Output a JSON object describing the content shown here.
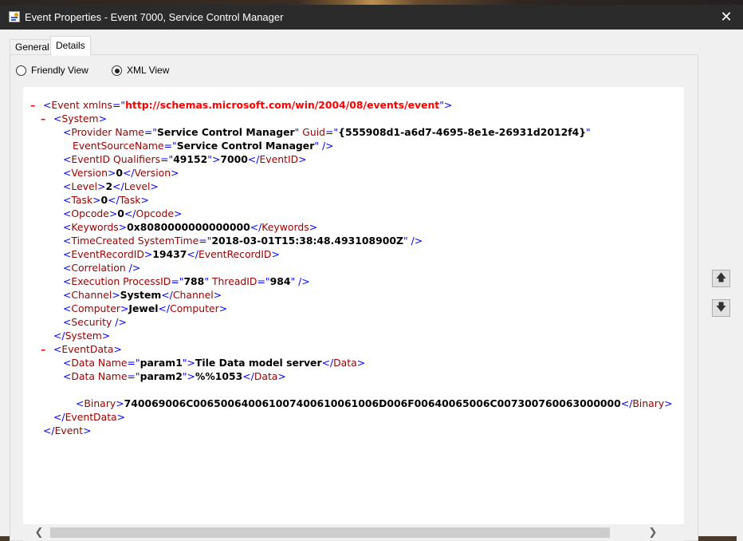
{
  "window": {
    "title": "Event Properties - Event 7000, Service Control Manager",
    "close_glyph": "✕"
  },
  "tabs": [
    {
      "label": "General",
      "selected": false
    },
    {
      "label": "Details",
      "selected": true
    }
  ],
  "view_options": {
    "friendly_label": "Friendly View",
    "xml_label": "XML View",
    "selected": "XML View"
  },
  "xml_view": {
    "lines": [
      {
        "indent": 0,
        "collapse": "–",
        "tokens": [
          [
            "t",
            "<"
          ],
          [
            "n",
            "Event "
          ],
          [
            "t",
            ""
          ],
          [
            "n",
            "xmlns"
          ],
          [
            "t",
            "=\""
          ],
          [
            "u",
            "http://schemas.microsoft.com/win/2004/08/events/event"
          ],
          [
            "t",
            "\">"
          ]
        ]
      },
      {
        "indent": 1,
        "collapse": "–",
        "tokens": [
          [
            "t",
            "<"
          ],
          [
            "n",
            "System"
          ],
          [
            "t",
            ">"
          ]
        ]
      },
      {
        "indent": 2,
        "collapse": "",
        "tokens": [
          [
            "t",
            "<"
          ],
          [
            "n",
            "Provider "
          ],
          [
            "n",
            "Name"
          ],
          [
            "t",
            "=\""
          ],
          [
            "v",
            "Service Control Manager"
          ],
          [
            "t",
            "\" "
          ],
          [
            "n",
            "Guid"
          ],
          [
            "t",
            "=\""
          ],
          [
            "v",
            "{555908d1-a6d7-4695-8e1e-26931d2012f4}"
          ],
          [
            "t",
            "\""
          ]
        ]
      },
      {
        "indent": 3,
        "collapse": "",
        "tokens": [
          [
            "n",
            "EventSourceName"
          ],
          [
            "t",
            "=\""
          ],
          [
            "v",
            "Service Control Manager"
          ],
          [
            "t",
            "\" />"
          ]
        ]
      },
      {
        "indent": 2,
        "collapse": "",
        "tokens": [
          [
            "t",
            "<"
          ],
          [
            "n",
            "EventID "
          ],
          [
            "n",
            "Qualifiers"
          ],
          [
            "t",
            "=\""
          ],
          [
            "v",
            "49152"
          ],
          [
            "t",
            "\">"
          ],
          [
            "v",
            "7000"
          ],
          [
            "t",
            "</"
          ],
          [
            "n",
            "EventID"
          ],
          [
            "t",
            ">"
          ]
        ]
      },
      {
        "indent": 2,
        "collapse": "",
        "tokens": [
          [
            "t",
            "<"
          ],
          [
            "n",
            "Version"
          ],
          [
            "t",
            ">"
          ],
          [
            "v",
            "0"
          ],
          [
            "t",
            "</"
          ],
          [
            "n",
            "Version"
          ],
          [
            "t",
            ">"
          ]
        ]
      },
      {
        "indent": 2,
        "collapse": "",
        "tokens": [
          [
            "t",
            "<"
          ],
          [
            "n",
            "Level"
          ],
          [
            "t",
            ">"
          ],
          [
            "v",
            "2"
          ],
          [
            "t",
            "</"
          ],
          [
            "n",
            "Level"
          ],
          [
            "t",
            ">"
          ]
        ]
      },
      {
        "indent": 2,
        "collapse": "",
        "tokens": [
          [
            "t",
            "<"
          ],
          [
            "n",
            "Task"
          ],
          [
            "t",
            ">"
          ],
          [
            "v",
            "0"
          ],
          [
            "t",
            "</"
          ],
          [
            "n",
            "Task"
          ],
          [
            "t",
            ">"
          ]
        ]
      },
      {
        "indent": 2,
        "collapse": "",
        "tokens": [
          [
            "t",
            "<"
          ],
          [
            "n",
            "Opcode"
          ],
          [
            "t",
            ">"
          ],
          [
            "v",
            "0"
          ],
          [
            "t",
            "</"
          ],
          [
            "n",
            "Opcode"
          ],
          [
            "t",
            ">"
          ]
        ]
      },
      {
        "indent": 2,
        "collapse": "",
        "tokens": [
          [
            "t",
            "<"
          ],
          [
            "n",
            "Keywords"
          ],
          [
            "t",
            ">"
          ],
          [
            "v",
            "0x8080000000000000"
          ],
          [
            "t",
            "</"
          ],
          [
            "n",
            "Keywords"
          ],
          [
            "t",
            ">"
          ]
        ]
      },
      {
        "indent": 2,
        "collapse": "",
        "tokens": [
          [
            "t",
            "<"
          ],
          [
            "n",
            "TimeCreated "
          ],
          [
            "n",
            "SystemTime"
          ],
          [
            "t",
            "=\""
          ],
          [
            "v",
            "2018-03-01T15:38:48.493108900Z"
          ],
          [
            "t",
            "\" />"
          ]
        ]
      },
      {
        "indent": 2,
        "collapse": "",
        "tokens": [
          [
            "t",
            "<"
          ],
          [
            "n",
            "EventRecordID"
          ],
          [
            "t",
            ">"
          ],
          [
            "v",
            "19437"
          ],
          [
            "t",
            "</"
          ],
          [
            "n",
            "EventRecordID"
          ],
          [
            "t",
            ">"
          ]
        ]
      },
      {
        "indent": 2,
        "collapse": "",
        "tokens": [
          [
            "t",
            "<"
          ],
          [
            "n",
            "Correlation"
          ],
          [
            "t",
            " />"
          ]
        ]
      },
      {
        "indent": 2,
        "collapse": "",
        "tokens": [
          [
            "t",
            "<"
          ],
          [
            "n",
            "Execution "
          ],
          [
            "n",
            "ProcessID"
          ],
          [
            "t",
            "=\""
          ],
          [
            "v",
            "788"
          ],
          [
            "t",
            "\" "
          ],
          [
            "n",
            "ThreadID"
          ],
          [
            "t",
            "=\""
          ],
          [
            "v",
            "984"
          ],
          [
            "t",
            "\" />"
          ]
        ]
      },
      {
        "indent": 2,
        "collapse": "",
        "tokens": [
          [
            "t",
            "<"
          ],
          [
            "n",
            "Channel"
          ],
          [
            "t",
            ">"
          ],
          [
            "v",
            "System"
          ],
          [
            "t",
            "</"
          ],
          [
            "n",
            "Channel"
          ],
          [
            "t",
            ">"
          ]
        ]
      },
      {
        "indent": 2,
        "collapse": "",
        "tokens": [
          [
            "t",
            "<"
          ],
          [
            "n",
            "Computer"
          ],
          [
            "t",
            ">"
          ],
          [
            "v",
            "Jewel"
          ],
          [
            "t",
            "</"
          ],
          [
            "n",
            "Computer"
          ],
          [
            "t",
            ">"
          ]
        ]
      },
      {
        "indent": 2,
        "collapse": "",
        "tokens": [
          [
            "t",
            "<"
          ],
          [
            "n",
            "Security"
          ],
          [
            "t",
            " />"
          ]
        ]
      },
      {
        "indent": 1,
        "collapse": "",
        "tokens": [
          [
            "t",
            "</"
          ],
          [
            "n",
            "System"
          ],
          [
            "t",
            ">"
          ]
        ]
      },
      {
        "indent": 1,
        "collapse": "–",
        "tokens": [
          [
            "t",
            "<"
          ],
          [
            "n",
            "EventData"
          ],
          [
            "t",
            ">"
          ]
        ]
      },
      {
        "indent": 2,
        "collapse": "",
        "tokens": [
          [
            "t",
            "<"
          ],
          [
            "n",
            "Data "
          ],
          [
            "n",
            "Name"
          ],
          [
            "t",
            "=\""
          ],
          [
            "v",
            "param1"
          ],
          [
            "t",
            "\">"
          ],
          [
            "v",
            "Tile Data model server"
          ],
          [
            "t",
            "</"
          ],
          [
            "n",
            "Data"
          ],
          [
            "t",
            ">"
          ]
        ]
      },
      {
        "indent": 2,
        "collapse": "",
        "tokens": [
          [
            "t",
            "<"
          ],
          [
            "n",
            "Data "
          ],
          [
            "n",
            "Name"
          ],
          [
            "t",
            "=\""
          ],
          [
            "v",
            "param2"
          ],
          [
            "t",
            "\">"
          ],
          [
            "v",
            "%%1053"
          ],
          [
            "t",
            "</"
          ],
          [
            "n",
            "Data"
          ],
          [
            "t",
            ">"
          ]
        ]
      },
      {
        "indent": 2,
        "collapse": "",
        "tokens": []
      },
      {
        "indent": 4,
        "collapse": "",
        "tokens": [
          [
            "t",
            "<"
          ],
          [
            "n",
            "Binary"
          ],
          [
            "t",
            ">"
          ],
          [
            "v",
            "740069006C006500640061007400610061006D006F00640065006C007300760063000000"
          ],
          [
            "t",
            "</"
          ],
          [
            "n",
            "Binary"
          ],
          [
            "t",
            ">"
          ]
        ]
      },
      {
        "indent": 1,
        "collapse": "",
        "tokens": [
          [
            "t",
            "</"
          ],
          [
            "n",
            "EventData"
          ],
          [
            "t",
            ">"
          ]
        ]
      },
      {
        "indent": 0,
        "collapse": "",
        "tokens": [
          [
            "t",
            "</"
          ],
          [
            "n",
            "Event"
          ],
          [
            "t",
            ">"
          ]
        ]
      }
    ]
  },
  "scroll": {
    "up_glyph": "⌃",
    "down_glyph": "⌄",
    "left_glyph": "❮",
    "right_glyph": "❯"
  },
  "nav": {
    "prev_glyph": "🡅",
    "next_glyph": "🡇"
  }
}
